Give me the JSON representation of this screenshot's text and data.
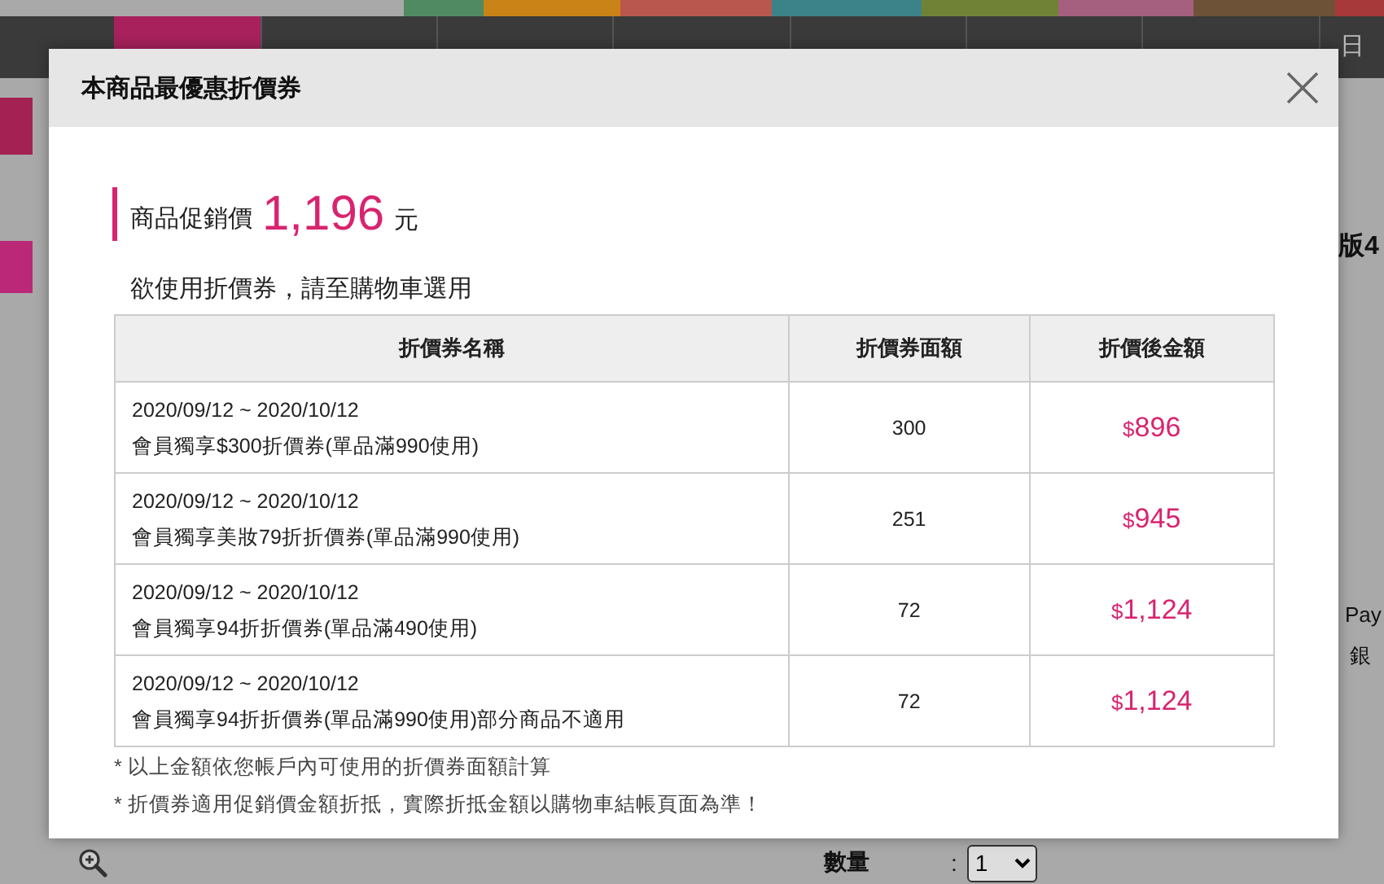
{
  "background": {
    "color_tabs": [
      {
        "color": "#4f8a63"
      },
      {
        "color": "#c98317"
      },
      {
        "color": "#b9574f"
      },
      {
        "color": "#3c8389"
      },
      {
        "color": "#6f8236"
      },
      {
        "color": "#a5607f"
      },
      {
        "color": "#6e5238"
      },
      {
        "color": "#a8393b"
      }
    ],
    "nav_tabs": [
      {
        "selected": true
      },
      {
        "selected": false
      },
      {
        "selected": false
      },
      {
        "selected": false
      },
      {
        "selected": false
      },
      {
        "selected": false
      },
      {
        "selected": false
      },
      {
        "label": "日",
        "selected": false
      }
    ],
    "side_texts": [
      "版4",
      "Pay",
      "銀"
    ],
    "quantity": {
      "label": "數量",
      "separator": ":",
      "value": "1"
    }
  },
  "dialog": {
    "title": "本商品最優惠折價券",
    "price": {
      "label": "商品促銷價",
      "amount": "1,196",
      "unit": "元"
    },
    "hint": "欲使用折價券，請至購物車選用",
    "table": {
      "columns": [
        "折價券名稱",
        "折價券面額",
        "折價後金額"
      ],
      "rows": [
        {
          "period": "2020/09/12 ~ 2020/10/12",
          "name": "會員獨享$300折價券(單品滿990使用)",
          "face_value": "300",
          "currency": "$",
          "final_amount": "896"
        },
        {
          "period": "2020/09/12 ~ 2020/10/12",
          "name": "會員獨享美妝79折折價券(單品滿990使用)",
          "face_value": "251",
          "currency": "$",
          "final_amount": "945"
        },
        {
          "period": "2020/09/12 ~ 2020/10/12",
          "name": "會員獨享94折折價券(單品滿490使用)",
          "face_value": "72",
          "currency": "$",
          "final_amount": "1,124"
        },
        {
          "period": "2020/09/12 ~ 2020/10/12",
          "name": "會員獨享94折折價券(單品滿990使用)部分商品不適用",
          "face_value": "72",
          "currency": "$",
          "final_amount": "1,124"
        }
      ]
    },
    "notes": [
      "* 以上金額依您帳戶內可使用的折價券面額計算",
      "* 折價券適用促銷價金額折抵，實際折抵金額以購物車結帳頁面為準！"
    ]
  }
}
